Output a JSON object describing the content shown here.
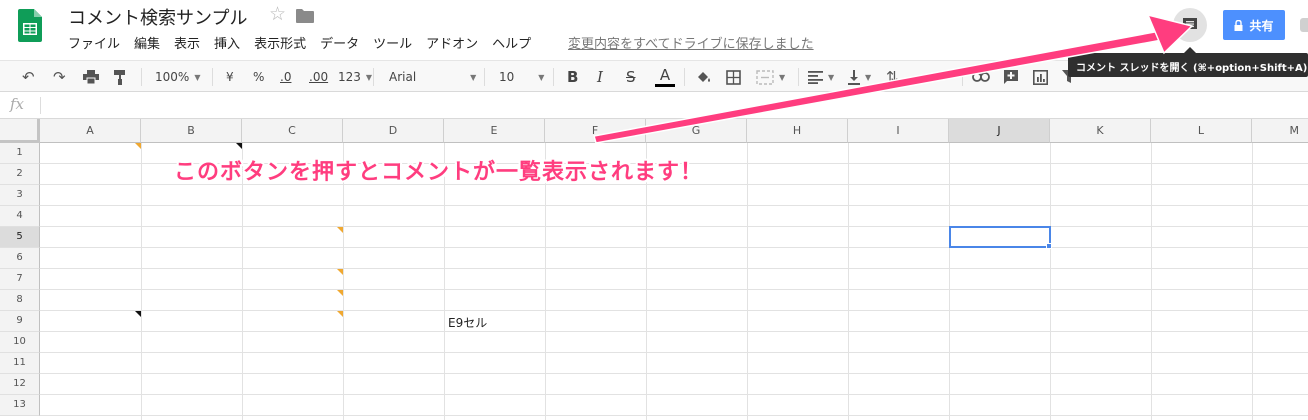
{
  "header": {
    "title": "コメント検索サンプル",
    "menu": [
      "ファイル",
      "編集",
      "表示",
      "挿入",
      "表示形式",
      "データ",
      "ツール",
      "アドオン",
      "ヘルプ"
    ],
    "save_status": "変更内容をすべてドライブに保存しました",
    "share_label": "共有",
    "tooltip": "コメント スレッドを開く (⌘+option+Shift+A)"
  },
  "toolbar": {
    "zoom": "100%",
    "currency": "¥",
    "percent": "%",
    "decimal_less": ".0",
    "decimal_more": ".00",
    "more_formats": "123",
    "font": "Arial",
    "font_size": "10",
    "bold": "B",
    "italic": "I",
    "strikethrough": "S",
    "text_color": "A"
  },
  "formula_bar": {
    "fx": "fx"
  },
  "grid": {
    "columns": [
      "A",
      "B",
      "C",
      "D",
      "E",
      "F",
      "G",
      "H",
      "I",
      "J",
      "K",
      "L",
      "M"
    ],
    "rows": [
      "1",
      "2",
      "3",
      "4",
      "5",
      "6",
      "7",
      "8",
      "9",
      "10",
      "11",
      "12",
      "13"
    ],
    "selected_cell": "J5",
    "cells": [
      {
        "ref": "E9",
        "value": "E9セル"
      }
    ]
  },
  "annotation": {
    "text": "このボタンを押すとコメントが一覧表示されます！"
  },
  "colors": {
    "share_button": "#4d90fe",
    "selection": "#4a86e8",
    "annotation": "#ff3d7f",
    "note_marker": "#f0a830",
    "sheets_green": "#0f9d58"
  },
  "icons": [
    "sheets-logo",
    "star-icon",
    "folder-icon",
    "comment-icon",
    "lock-icon",
    "undo-icon",
    "redo-icon",
    "print-icon",
    "paint-format-icon",
    "fill-color-icon",
    "borders-icon",
    "merge-icon",
    "align-icon",
    "valign-icon",
    "link-icon",
    "insert-comment-icon",
    "chart-icon",
    "filter-icon",
    "fx-icon"
  ]
}
